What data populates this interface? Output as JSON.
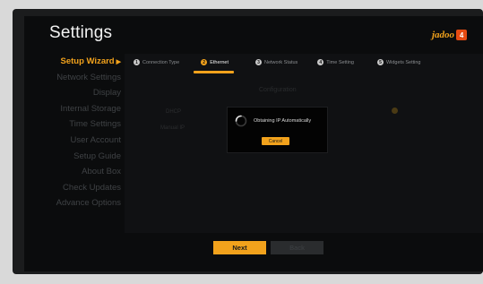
{
  "header": {
    "title": "Settings",
    "logo_text": "jadoo",
    "logo_badge": "4"
  },
  "sidebar": {
    "items": [
      {
        "label": "Setup Wizard",
        "active": true
      },
      {
        "label": "Network Settings"
      },
      {
        "label": "Display"
      },
      {
        "label": "Internal Storage"
      },
      {
        "label": "Time Settings"
      },
      {
        "label": "User Account"
      },
      {
        "label": "Setup Guide"
      },
      {
        "label": "About Box"
      },
      {
        "label": "Check Updates"
      },
      {
        "label": "Advance Options"
      }
    ]
  },
  "wizard": {
    "steps": [
      {
        "num": "1",
        "label": "Connection Type"
      },
      {
        "num": "2",
        "label": "Ethernet",
        "active": true
      },
      {
        "num": "3",
        "label": "Network Status"
      },
      {
        "num": "4",
        "label": "Time Setting"
      },
      {
        "num": "5",
        "label": "Widgets Setting"
      }
    ],
    "dim_header": "Configuration",
    "dim_label_1": "DHCP",
    "dim_label_2": "Manual IP"
  },
  "dialog": {
    "message": "Obtaining IP Automatically",
    "cancel_label": "Cancel"
  },
  "footer": {
    "next_label": "Next",
    "back_label": "Back"
  },
  "colors": {
    "accent": "#f2a21c",
    "background": "#0b0c0d",
    "inactive_text": "#3f4245"
  }
}
